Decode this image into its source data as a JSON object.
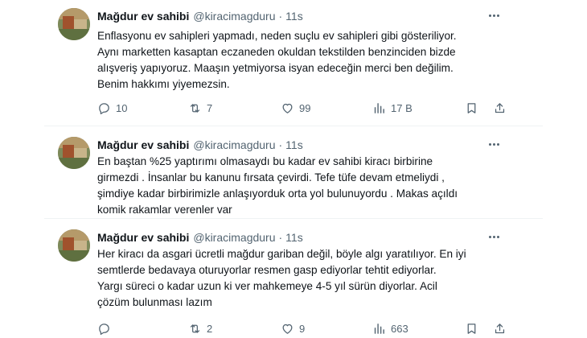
{
  "tweets": [
    {
      "name": "Mağdur ev sahibi",
      "handle": "@kiracimagduru",
      "separator": "·",
      "time": "11s",
      "lines": [
        "Enflasyonu ev sahipleri yapmadı, neden suçlu ev sahipleri gibi gösteriliyor.",
        "Aynı marketten kasaptan eczaneden okuldan tekstilden benzinciden bizde",
        "alışveriş yapıyoruz. Maaşın yetmiyorsa isyan edeceğin merci ben değilim.",
        "Benim hakkımı yiyemezsin."
      ],
      "replies": "10",
      "retweets": "7",
      "likes": "99",
      "views": "17 B"
    },
    {
      "name": "Mağdur ev sahibi",
      "handle": "@kiracimagduru",
      "separator": "·",
      "time": "11s",
      "lines": [
        "En baştan %25 yaptırımı olmasaydı bu kadar ev sahibi kiracı birbirine",
        "girmezdi . İnsanlar bu kanunu fırsata çevirdi. Tefe tüfe devam etmeliydi ,",
        "şimdiye kadar birbirimizle anlaşıyorduk orta yol bulunuyordu . Makas açıldı",
        "komik rakamlar verenler var"
      ]
    },
    {
      "name": "Mağdur ev sahibi",
      "handle": "@kiracimagduru",
      "separator": "·",
      "time": "11s",
      "lines": [
        "Her kiracı da asgari ücretli mağdur gariban değil, böyle algı yaratılıyor. En iyi",
        "semtlerde bedavaya oturuyorlar resmen gasp ediyorlar tehtit ediyorlar.",
        "Yargı süreci o kadar uzun ki ver mahkemeye 4-5 yıl sürün diyorlar. Acil",
        "çözüm bulunması lazım"
      ],
      "replies": "",
      "retweets": "2",
      "likes": "9",
      "views": "663"
    }
  ],
  "icons": {
    "reply": "reply-icon",
    "retweet": "retweet-icon",
    "like": "heart-icon",
    "views": "views-chart-icon",
    "bookmark": "bookmark-icon",
    "share": "share-icon",
    "more": "more-dots-icon"
  },
  "colors": {
    "text": "#0f1419",
    "secondary": "#536471",
    "divider": "#eff3f4"
  }
}
